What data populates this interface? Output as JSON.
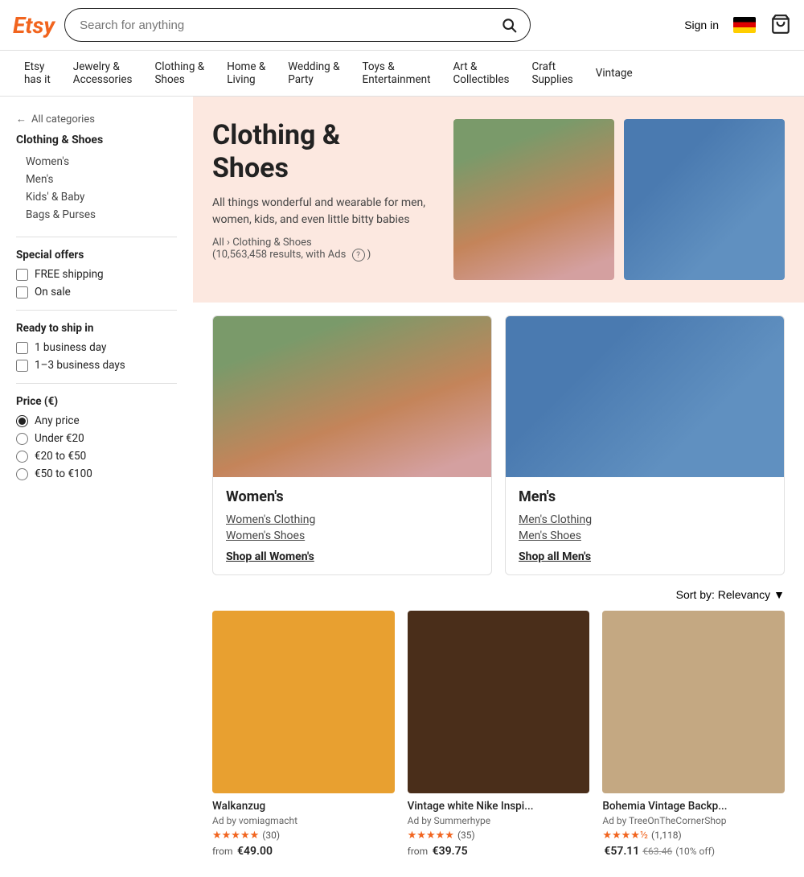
{
  "header": {
    "logo": "Etsy",
    "search_placeholder": "Search for anything",
    "sign_in": "Sign in",
    "cart_label": "Cart"
  },
  "nav": {
    "items": [
      {
        "id": "etsy-has-it",
        "label": "Etsy\nhas it"
      },
      {
        "id": "jewelry",
        "label": "Jewelry &\nAccessories"
      },
      {
        "id": "clothing",
        "label": "Clothing &\nShoes"
      },
      {
        "id": "home",
        "label": "Home &\nLiving"
      },
      {
        "id": "wedding",
        "label": "Wedding &\nParty"
      },
      {
        "id": "toys",
        "label": "Toys &\nEntertainment"
      },
      {
        "id": "art",
        "label": "Art &\nCollectibles"
      },
      {
        "id": "craft",
        "label": "Craft\nSupplies"
      },
      {
        "id": "vintage",
        "label": "Vintage"
      }
    ]
  },
  "hero": {
    "title": "Clothing &\nShoes",
    "description": "All things wonderful and wearable for men, women, kids, and even little bitty babies",
    "breadcrumb_all": "All",
    "breadcrumb_cat": "Clothing & Shoes",
    "results": "(10,563,458 results, with Ads",
    "info_icon": "?"
  },
  "sidebar": {
    "back_label": "All categories",
    "category_title": "Clothing & Shoes",
    "subcategories": [
      "Women's",
      "Men's",
      "Kids' & Baby",
      "Bags & Purses"
    ],
    "special_offers_title": "Special offers",
    "special_offers": [
      {
        "id": "free-shipping",
        "label": "FREE shipping"
      },
      {
        "id": "on-sale",
        "label": "On sale"
      }
    ],
    "ready_to_ship_title": "Ready to ship in",
    "ready_to_ship": [
      {
        "id": "1-day",
        "label": "1 business day"
      },
      {
        "id": "1-3-days",
        "label": "1–3 business days"
      }
    ],
    "price_title": "Price (€)",
    "price_options": [
      {
        "id": "any",
        "label": "Any price",
        "checked": true
      },
      {
        "id": "under-20",
        "label": "Under €20",
        "checked": false
      },
      {
        "id": "20-50",
        "label": "€20 to €50",
        "checked": false
      },
      {
        "id": "50-100",
        "label": "€50 to €100",
        "checked": false
      }
    ]
  },
  "category_cards": [
    {
      "id": "womens",
      "title": "Women's",
      "links": [
        "Women's Clothing",
        "Women's Shoes"
      ],
      "shop_all": "Shop all Women's"
    },
    {
      "id": "mens",
      "title": "Men's",
      "links": [
        "Men's Clothing",
        "Men's Shoes"
      ],
      "shop_all": "Shop all Men's"
    }
  ],
  "sort": {
    "label": "Sort by: Relevancy",
    "arrow": "▼"
  },
  "products": [
    {
      "id": "walkanzug",
      "name": "Walkanzug",
      "ad_label": "Ad by vomiagmacht",
      "stars": "★★★★★",
      "star_count": "(30)",
      "price_prefix": "from",
      "price": "€49.00",
      "img_class": "img-orange"
    },
    {
      "id": "nike-hoodie",
      "name": "Vintage white Nike Inspi...",
      "ad_label": "Ad by Summerhype",
      "stars": "★★★★★",
      "star_count": "(35)",
      "price_prefix": "from",
      "price": "€39.75",
      "img_class": "img-brown"
    },
    {
      "id": "backpack",
      "name": "Bohemia Vintage Backp...",
      "ad_label": "Ad by TreeOnTheCornerShop",
      "stars": "★★★★½",
      "star_count": "(1,118)",
      "price_prefix": "",
      "price": "€57.11",
      "original_price": "€63.46",
      "discount": "(10% off)",
      "img_class": "img-tan"
    }
  ]
}
